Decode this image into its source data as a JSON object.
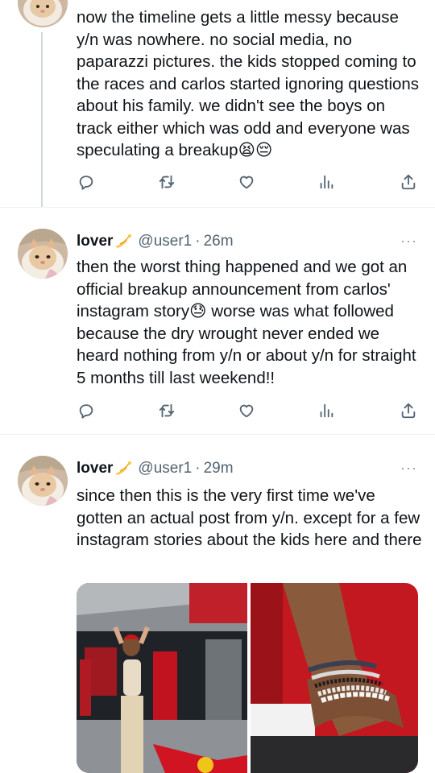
{
  "tweets": [
    {
      "text": "now the timeline gets a little messy because y/n was nowhere. no social media, no paparazzi pictures. the kids stopped coming to the races and carlos started ignoring questions about his family. we didn't see the boys on track either which was odd and everyone was speculating a breakup😫😔"
    },
    {
      "name": "lover",
      "handle": "@user1",
      "sep": "·",
      "time": "26m",
      "more": "···",
      "text": "then the worst thing happened and we got an official breakup announcement from carlos' instagram story😓 worse was what followed because the dry wrought never ended we heard nothing from y/n or about y/n for straight 5 months till last weekend!!"
    },
    {
      "name": "lover",
      "handle": "@user1",
      "sep": "·",
      "time": "29m",
      "more": "···",
      "text": "since then this is the very first time we've gotten an actual post from y/n. except for a few instagram stories about the kids here and there"
    }
  ],
  "icons": {
    "reply": "reply-icon",
    "retweet": "retweet-icon",
    "like": "like-icon",
    "views": "views-icon",
    "share": "share-icon",
    "more": "more-icon",
    "name_emoji": "dizzy-emoji-icon"
  },
  "colors": {
    "text": "#0f1419",
    "secondary": "#536471",
    "divider": "#eff3f4",
    "thread_line": "#cfd9de"
  }
}
